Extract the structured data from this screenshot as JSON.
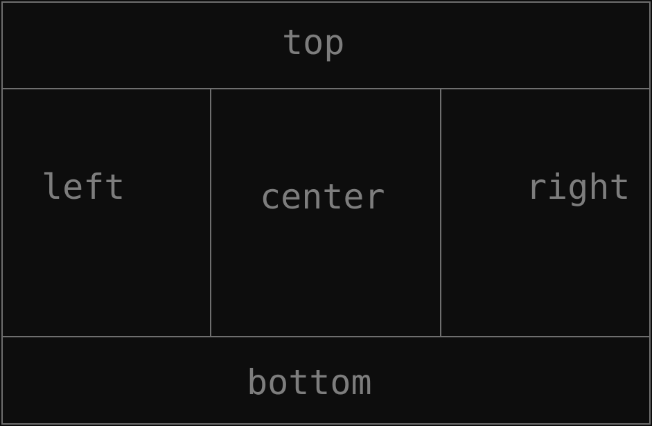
{
  "regions": {
    "top": {
      "label": "top"
    },
    "left": {
      "label": "left"
    },
    "center": {
      "label": "center"
    },
    "right": {
      "label": "right"
    },
    "bottom": {
      "label": "bottom"
    }
  },
  "colors": {
    "background": "#0d0d0d",
    "border": "#6e6e6e",
    "text": "#7d7d7d"
  }
}
